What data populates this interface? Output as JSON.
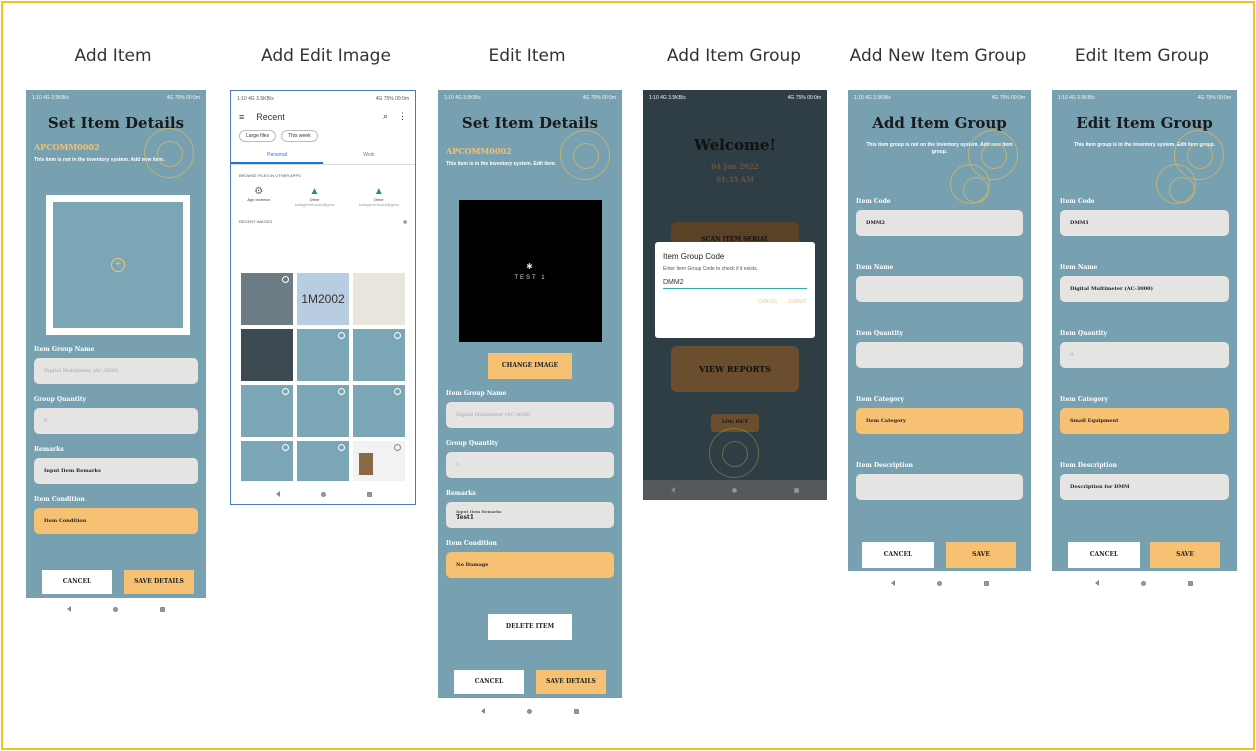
{
  "captions": [
    "Add Item",
    "Add Edit Image",
    "Edit Item",
    "Add Item Group",
    "Add New Item Group",
    "Edit Item Group"
  ],
  "status_time": "1:10 4G 3.5KB/s",
  "status_right": "4G 75% 00:0m",
  "add_item": {
    "title": "Set Item Details",
    "code": "APCOMM0002",
    "desc": "This item is not in the inventory system. Add new item.",
    "group_name_label": "Item Group Name",
    "group_name_value": "Digital Multimeter (AC-3000)",
    "qty_label": "Group Quantity",
    "qty_value": "0",
    "remarks_label": "Remarks",
    "remarks_value": "Input Item Remarks",
    "condition_label": "Item Condition",
    "condition_value": "Item Condition",
    "cancel": "CANCEL",
    "save": "SAVE DETAILS"
  },
  "gallery": {
    "header": "Recent",
    "chip1": "Large files",
    "chip2": "This week",
    "tab1": "Personal",
    "tab2": "Work",
    "browse": "BROWSE FILES IN OTHER APPS",
    "apps": [
      "App Inventor",
      "Drive",
      "Drive"
    ],
    "apps_sub": [
      "",
      "todayjeremoore@gma",
      "todayjeremoore@gma"
    ],
    "recent": "RECENT IMAGES",
    "thumb_text": "1M2002"
  },
  "edit_item": {
    "title": "Set Item Details",
    "code": "APCOMM0002",
    "desc": "This item is in the inventory system. Edit item.",
    "image_text": "TEST 1",
    "change_image": "CHANGE IMAGE",
    "group_name_label": "Item Group Name",
    "group_name_value": "Digital Multimeter (AC-3000)",
    "qty_label": "Group Quantity",
    "qty_value": "1",
    "remarks_label": "Remarks",
    "remarks_hint": "Input Item Remarks",
    "remarks_value": "Test1",
    "condition_label": "Item Condition",
    "condition_value": "No Damage",
    "delete": "DELETE ITEM",
    "cancel": "CANCEL",
    "save": "SAVE DETAILS"
  },
  "add_group": {
    "welcome": "Welcome!",
    "date": "04 Jun 2022",
    "time": "01:35 AM",
    "scan_btn": "SCAN ITEM SERIAL",
    "dialog_title": "Item Group Code",
    "dialog_text": "Enter Item Group Code to check if it exists.",
    "dialog_value": "DMM2",
    "dialog_cancel": "CANCEL",
    "dialog_submit": "SUBMIT",
    "reports": "VIEW REPORTS",
    "logout": "LOG OUT"
  },
  "new_group": {
    "title": "Add Item Group",
    "desc": "This item group is not on the inventory system. Add new item group.",
    "code_label": "Item Code",
    "code_value": "DMM2",
    "name_label": "Item Name",
    "name_value": "",
    "qty_label": "Item Quantity",
    "qty_value": "",
    "cat_label": "Item Category",
    "cat_value": "Item Category",
    "desc_label": "Item Description",
    "desc_value": "",
    "cancel": "CANCEL",
    "save": "SAVE"
  },
  "edit_group": {
    "title": "Edit Item Group",
    "desc": "This item group is in the inventory system. Edit item group.",
    "code_label": "Item Code",
    "code_value": "DMM1",
    "name_label": "Item Name",
    "name_value": "Digital Multimeter (AC-3000)",
    "qty_label": "Item Quantity",
    "qty_value": "0",
    "cat_label": "Item Category",
    "cat_value": "Small Equipment",
    "desc_label": "Item Description",
    "desc_value": "Description for DMM",
    "cancel": "CANCEL",
    "save": "SAVE"
  },
  "colors": {
    "frame": "#f0c419",
    "phone_bg": "#77a1b1",
    "accent": "#f6c172",
    "dark_bg": "#2f3e44",
    "brown": "#6b4e2e"
  }
}
